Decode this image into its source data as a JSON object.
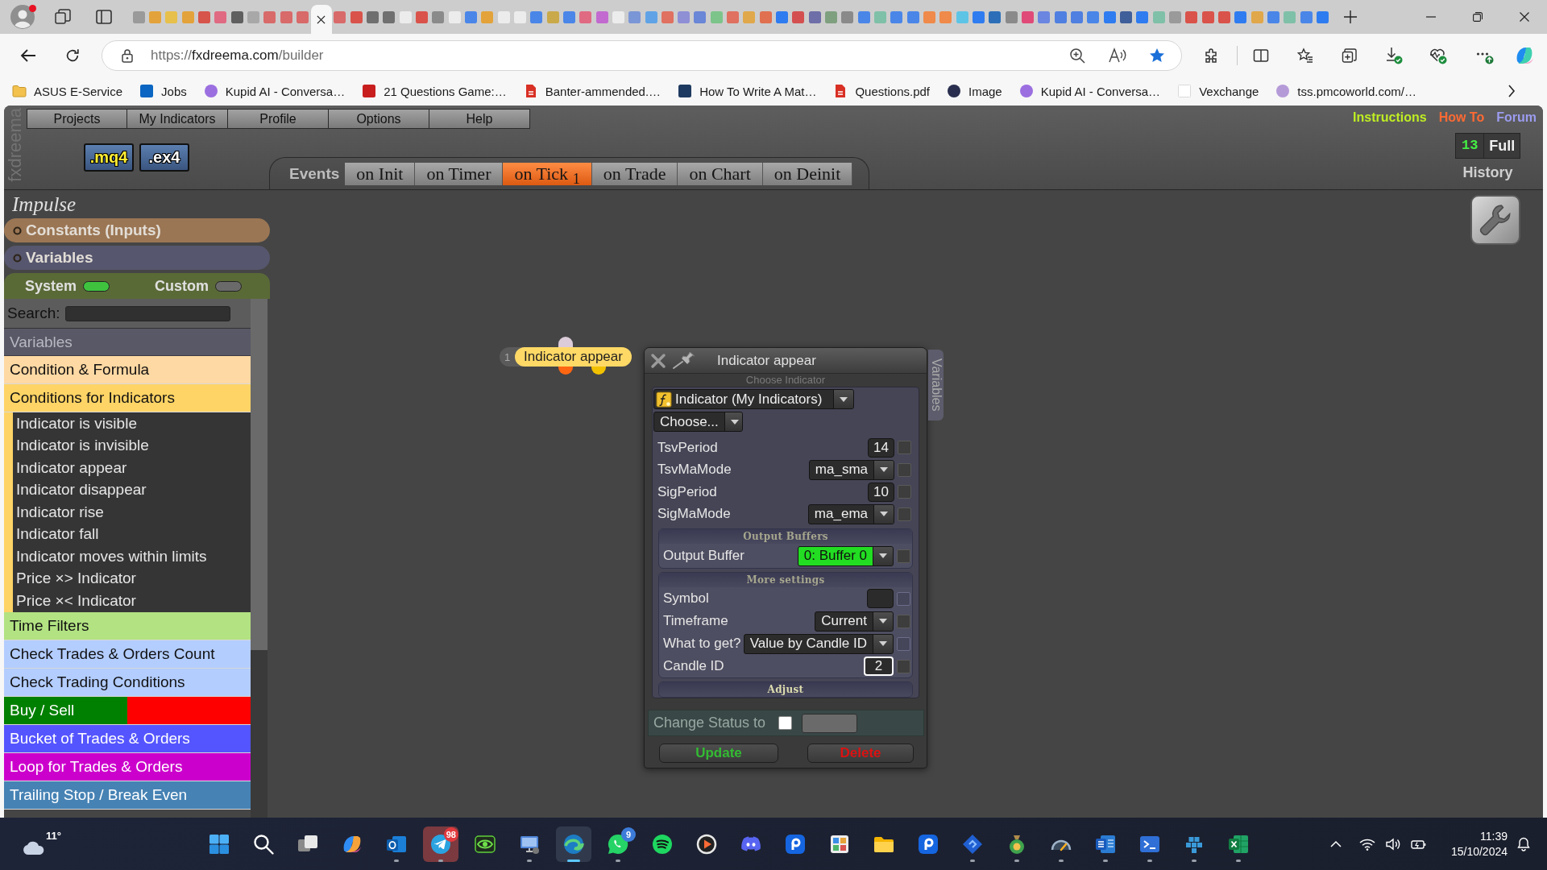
{
  "browser": {
    "tabs": [
      {
        "color": "#9a9a9a",
        "selected": false
      },
      {
        "color": "#e3a33a",
        "selected": false
      },
      {
        "color": "#e6c04a",
        "selected": false
      },
      {
        "color": "#e3a33a",
        "selected": false
      },
      {
        "color": "#d6544a",
        "selected": false
      },
      {
        "color": "#e06a82",
        "selected": false
      },
      {
        "color": "#5f5f5f",
        "selected": false
      },
      {
        "color": "#a8a8a8",
        "selected": false
      },
      {
        "color": "#d86a6a",
        "selected": false
      },
      {
        "color": "#d86a6a",
        "selected": false
      },
      {
        "color": "#d86a6a",
        "selected": false
      },
      {
        "selected": true
      },
      {
        "color": "#d86a6a",
        "selected": false
      },
      {
        "color": "#d9534a",
        "selected": false
      },
      {
        "color": "#6f6f6f",
        "selected": false
      },
      {
        "color": "#6f6f6f",
        "selected": false
      },
      {
        "color": "#ececec",
        "selected": false
      },
      {
        "color": "#d9534a",
        "selected": false
      },
      {
        "color": "#8a8a8a",
        "selected": false
      },
      {
        "color": "#ececec",
        "selected": false
      },
      {
        "color": "#4a86e8",
        "selected": false
      },
      {
        "color": "#e3a33a",
        "selected": false
      },
      {
        "color": "#ececec",
        "selected": false
      },
      {
        "color": "#ececec",
        "selected": false
      },
      {
        "color": "#4a86e8",
        "selected": false
      },
      {
        "color": "#c9a94a",
        "selected": false
      },
      {
        "color": "#4a86e8",
        "selected": false
      },
      {
        "color": "#e06a82",
        "selected": false
      },
      {
        "color": "#c26ad0",
        "selected": false
      },
      {
        "color": "#ececec",
        "selected": false
      },
      {
        "color": "#7b96d6",
        "selected": false
      },
      {
        "color": "#5fa3e6",
        "selected": false
      },
      {
        "color": "#e07060",
        "selected": false
      },
      {
        "color": "#8f8fd6",
        "selected": false
      },
      {
        "color": "#6a86d6",
        "selected": false
      },
      {
        "color": "#7cc48a",
        "selected": false
      },
      {
        "color": "#e07060",
        "selected": false
      },
      {
        "color": "#e0a84a",
        "selected": false
      },
      {
        "color": "#e07050",
        "selected": false
      },
      {
        "color": "#2f7cf0",
        "selected": false
      },
      {
        "color": "#d45050",
        "selected": false
      },
      {
        "color": "#6e6ea8",
        "selected": false
      },
      {
        "color": "#7fa07f",
        "selected": false
      },
      {
        "color": "#8a8a8a",
        "selected": false
      },
      {
        "color": "#4a86e8",
        "selected": false
      },
      {
        "color": "#7fc0a8",
        "selected": false
      },
      {
        "color": "#4a86e8",
        "selected": false
      },
      {
        "color": "#4a86e8",
        "selected": false
      },
      {
        "color": "#ef8a4a",
        "selected": false
      },
      {
        "color": "#ef8a4a",
        "selected": false
      },
      {
        "color": "#5ec4e6",
        "selected": false
      },
      {
        "color": "#2f7cf0",
        "selected": false
      },
      {
        "color": "#2c6fb8",
        "selected": false
      },
      {
        "color": "#8a8a8a",
        "selected": false
      },
      {
        "color": "#e04a78",
        "selected": false
      },
      {
        "color": "#6a86e0",
        "selected": false
      },
      {
        "color": "#4f7fe0",
        "selected": false
      },
      {
        "color": "#4f7fe0",
        "selected": false
      },
      {
        "color": "#4a86e8",
        "selected": false
      },
      {
        "color": "#2f7cf0",
        "selected": false
      },
      {
        "color": "#3f5f9a",
        "selected": false
      },
      {
        "color": "#2f7cf0",
        "selected": false
      },
      {
        "color": "#7fc0a8",
        "selected": false
      },
      {
        "color": "#9a9a9a",
        "selected": false
      },
      {
        "color": "#d9534a",
        "selected": false
      },
      {
        "color": "#d9534a",
        "selected": false
      },
      {
        "color": "#d9534a",
        "selected": false
      },
      {
        "color": "#2f7cf0",
        "selected": false
      },
      {
        "color": "#e0a84a",
        "selected": false
      },
      {
        "color": "#4a86e8",
        "selected": false
      },
      {
        "color": "#7fc0a8",
        "selected": false
      },
      {
        "color": "#4a86e8",
        "selected": false
      },
      {
        "color": "#2f7cf0",
        "selected": false
      }
    ],
    "address": {
      "scheme": "https://",
      "host": "fxdreema.com",
      "path": "/builder"
    },
    "bookmarks": [
      {
        "kind": "folder",
        "color": "#f2c14e",
        "label": "ASUS E-Service"
      },
      {
        "kind": "tile",
        "color": "#0a66c2",
        "label": "Jobs"
      },
      {
        "kind": "circle",
        "color": "#9b6fe0",
        "label": "Kupid AI - Conversa…"
      },
      {
        "kind": "tile",
        "color": "#c81e1e",
        "label": "21 Questions Game:…"
      },
      {
        "kind": "doc",
        "color": "#d93025",
        "label": "Banter-ammended.…"
      },
      {
        "kind": "tile",
        "color": "#1f3a60",
        "label": "How To Write A Mat…"
      },
      {
        "kind": "doc",
        "color": "#d93025",
        "label": "Questions.pdf"
      },
      {
        "kind": "circle",
        "color": "#2a2f4f",
        "label": "Image"
      },
      {
        "kind": "circle",
        "color": "#9b6fe0",
        "label": "Kupid AI - Conversa…"
      },
      {
        "kind": "blank",
        "color": "#ffffff",
        "label": "Vexchange"
      },
      {
        "kind": "circle",
        "color": "#b59ad8",
        "label": "tss.pmcoworld.com/…"
      }
    ]
  },
  "app": {
    "logo": "fxdreema",
    "menu": [
      "Projects",
      "My Indicators",
      "Profile",
      "Options",
      "Help"
    ],
    "links": [
      {
        "label": "Instructions",
        "color": "#bfee22"
      },
      {
        "label": "How To",
        "color": "#ff6a33"
      },
      {
        "label": "Forum",
        "color": "#9c9cf0"
      }
    ],
    "file_buttons": [
      {
        "label": ".mq4",
        "kind": "source"
      },
      {
        "label": ".ex4",
        "kind": "compiled"
      }
    ],
    "events": {
      "label": "Events",
      "tabs": [
        {
          "label": "on Init",
          "selected": false
        },
        {
          "label": "on Timer",
          "selected": false
        },
        {
          "label": "on Tick $_{1}$",
          "selected": true
        },
        {
          "label": "on Trade",
          "selected": false
        },
        {
          "label": "on Chart",
          "selected": false
        },
        {
          "label": "on Deinit",
          "selected": false
        }
      ]
    },
    "history": {
      "count": "13",
      "mode": "Full",
      "label": "History"
    },
    "project": "Impulse",
    "sections": [
      {
        "label": "Constants (Inputs)",
        "color": "#9b7654"
      },
      {
        "label": "Variables",
        "color": "#56566e"
      }
    ],
    "scopes": [
      {
        "label": "System",
        "on": true
      },
      {
        "label": "Custom",
        "on": false
      }
    ],
    "search": {
      "label": "Search:"
    },
    "categories": [
      {
        "kind": "header",
        "label": "Variables"
      },
      {
        "kind": "category",
        "label": "Condition & Formula",
        "color": "#ffd9a3"
      },
      {
        "kind": "category",
        "label": "Conditions for Indicators",
        "color": "#ffd466",
        "expanded": true,
        "children": [
          "Indicator is visible",
          "Indicator is invisible",
          "Indicator appear",
          "Indicator disappear",
          "Indicator rise",
          "Indicator fall",
          "Indicator moves within limits",
          "Price ×> Indicator",
          "Price ×< Indicator"
        ]
      },
      {
        "kind": "category",
        "label": "Time Filters",
        "color": "#b2e282"
      },
      {
        "kind": "category",
        "label": "Check Trades & Orders Count",
        "color": "#b3cdff"
      },
      {
        "kind": "category",
        "label": "Check Trading Conditions",
        "color": "#b3cdff"
      },
      {
        "kind": "split",
        "label": "Buy / Sell",
        "segments": [
          {
            "color": "#008000"
          },
          {
            "color": "#ff0000"
          }
        ]
      },
      {
        "kind": "category",
        "label": "Bucket of Trades & Orders",
        "color": "#5555ff"
      },
      {
        "kind": "category",
        "label": "Loop for Trades & Orders",
        "color": "#cc00cc"
      },
      {
        "kind": "category",
        "label": "Trailing Stop / Break Even",
        "color": "#4682b4"
      }
    ]
  },
  "canvas": {
    "node": {
      "number": "1",
      "label": "Indicator appear",
      "ports": [
        {
          "kind": "input",
          "color": "#dccbd9"
        },
        {
          "kind": "output",
          "color": "#ff6612"
        },
        {
          "kind": "output",
          "color": "#f2c200"
        }
      ]
    },
    "dialog": {
      "title": "Indicator appear",
      "subtitle": "Choose Indicator",
      "side_tab": "Variables",
      "source": "Indicator (My Indicators)",
      "choice": "Choose...",
      "params": [
        {
          "label": "TsvPeriod",
          "kind": "number",
          "value": "14",
          "checked": false,
          "disabled": false,
          "focused": false,
          "highlighted": false
        },
        {
          "label": "TsvMaMode",
          "kind": "select",
          "value": "ma_sma",
          "checked": false,
          "disabled": false,
          "focused": false,
          "highlighted": false
        },
        {
          "label": "SigPeriod",
          "kind": "number",
          "value": "10",
          "checked": false,
          "disabled": false,
          "focused": false,
          "highlighted": false
        },
        {
          "label": "SigMaMode",
          "kind": "select",
          "value": "ma_ema",
          "checked": false,
          "disabled": false,
          "focused": false,
          "highlighted": false
        }
      ],
      "sections": [
        {
          "title": "Output Buffers",
          "expanded": true,
          "rows": [
            {
              "label": "Output Buffer",
              "kind": "select",
              "value": "0: Buffer 0",
              "checked": false,
              "disabled": false,
              "focused": false,
              "highlighted": true
            }
          ]
        },
        {
          "title": "More settings",
          "expanded": true,
          "rows": [
            {
              "label": "Symbol",
              "kind": "text",
              "checked": false,
              "disabled": true,
              "focused": false,
              "highlighted": false
            },
            {
              "label": "Timeframe",
              "kind": "select",
              "value": "Current",
              "checked": false,
              "disabled": false,
              "focused": false,
              "highlighted": false
            },
            {
              "label": "What to get?",
              "kind": "select",
              "value": "Value by Candle ID",
              "checked": false,
              "disabled": true,
              "focused": false,
              "highlighted": false
            },
            {
              "label": "Candle ID",
              "kind": "number",
              "value": "2",
              "checked": false,
              "disabled": false,
              "focused": true,
              "highlighted": false
            }
          ]
        },
        {
          "title": "Adjust",
          "expanded": false
        }
      ],
      "status": {
        "label": "Change Status to",
        "checked": false
      },
      "buttons": [
        {
          "label": "Update",
          "kind": "update"
        },
        {
          "label": "Delete",
          "kind": "delete"
        }
      ]
    }
  },
  "taskbar": {
    "weather": "11°",
    "apps": [
      {
        "kind": "start",
        "running": false,
        "active": false,
        "attention": false
      },
      {
        "kind": "search",
        "running": false,
        "active": false,
        "attention": false
      },
      {
        "kind": "windows",
        "running": false,
        "active": false,
        "attention": false
      },
      {
        "kind": "swirl",
        "running": false,
        "active": false,
        "attention": false
      },
      {
        "kind": "mail",
        "running": true,
        "active": false,
        "attention": false
      },
      {
        "kind": "plane",
        "running": true,
        "active": false,
        "attention": true,
        "badge": {
          "text": "98",
          "color": "#e0393e"
        }
      },
      {
        "kind": "eye",
        "running": false,
        "active": false,
        "attention": false
      },
      {
        "kind": "monitor",
        "running": true,
        "active": false,
        "attention": false
      },
      {
        "kind": "browser",
        "running": true,
        "active": true,
        "attention": false
      },
      {
        "kind": "chat",
        "running": true,
        "active": false,
        "attention": false,
        "badge": {
          "text": "9",
          "color": "#3d7bd9"
        }
      },
      {
        "kind": "waves",
        "running": false,
        "active": false,
        "attention": false
      },
      {
        "kind": "play",
        "running": false,
        "active": false,
        "attention": false
      },
      {
        "kind": "controller",
        "running": false,
        "active": false,
        "attention": false
      },
      {
        "kind": "ptile",
        "running": false,
        "active": false,
        "attention": false
      },
      {
        "kind": "photos",
        "running": false,
        "active": false,
        "attention": false
      },
      {
        "kind": "folder",
        "running": false,
        "active": false,
        "attention": false
      },
      {
        "kind": "ptile",
        "running": false,
        "active": false,
        "attention": false
      },
      {
        "kind": "diamond",
        "running": true,
        "active": false,
        "attention": false
      },
      {
        "kind": "bag",
        "running": true,
        "active": false,
        "attention": false
      },
      {
        "kind": "gauge",
        "running": true,
        "active": false,
        "attention": false
      },
      {
        "kind": "doc",
        "running": true,
        "active": false,
        "attention": false
      },
      {
        "kind": "terminal",
        "running": true,
        "active": false,
        "attention": false
      },
      {
        "kind": "cubes",
        "running": true,
        "active": false,
        "attention": false
      },
      {
        "kind": "sheet",
        "running": true,
        "active": false,
        "attention": false
      }
    ],
    "clock": {
      "time": "11:39",
      "date": "15/10/2024"
    }
  }
}
